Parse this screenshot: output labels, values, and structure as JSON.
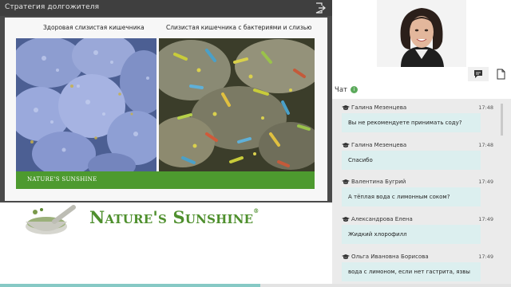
{
  "window": {
    "title": "Стратегия долгожителя"
  },
  "slide": {
    "caption_left": "Здоровая слизистая кишечника",
    "caption_right": "Слизистая кишечника с бактериями и слизью",
    "brand_small": "NATURE'S SUNSHINE"
  },
  "brand": {
    "name": "Nature's Sunshine",
    "mark": "®"
  },
  "panel": {
    "tabs": [
      {
        "icon": "chat-icon"
      },
      {
        "icon": "document-icon"
      }
    ]
  },
  "chat": {
    "title": "Чат",
    "info_symbol": "i",
    "messages": [
      {
        "author": "Галина Мезенцева",
        "time": "17:48",
        "text": "Вы не рекомендуете принимать соду?"
      },
      {
        "author": "Галина Мезенцева",
        "time": "17:48",
        "text": "Спасибо"
      },
      {
        "author": "Валентина Бугрий",
        "time": "17:49",
        "text": "А тёплая вода с лимонным соком?"
      },
      {
        "author": "Александрова Елена",
        "time": "17:49",
        "text": "Жидкий хлорофилл"
      },
      {
        "author": "Ольга Ивановна Борисова",
        "time": "17:49",
        "text": "вода с лимоном, если нет гастрита, язвы"
      }
    ]
  },
  "playback": {
    "progress": 0.51
  },
  "colors": {
    "brand_green": "#4e8f2d",
    "bubble": "#dcefef",
    "progress": "#86c9c5"
  }
}
